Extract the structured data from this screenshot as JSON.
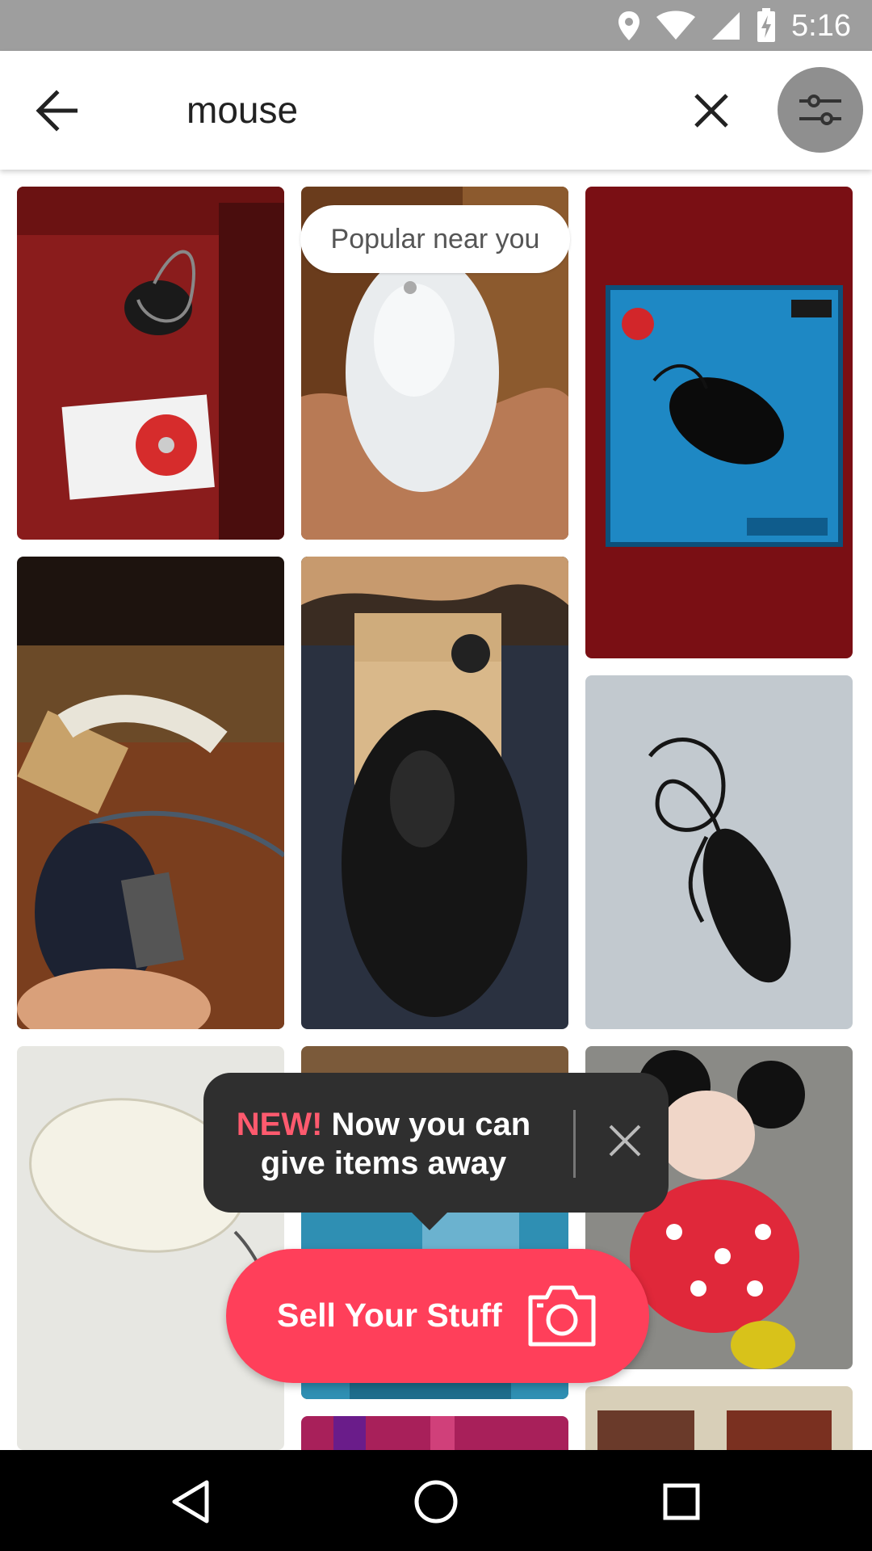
{
  "status_bar": {
    "time": "5:16",
    "icons": [
      "location-icon",
      "wifi-icon",
      "signal-icon",
      "battery-charging-icon"
    ]
  },
  "header": {
    "query": "mouse",
    "icons": [
      "back-arrow-icon",
      "clear-icon",
      "filter-sliders-icon"
    ]
  },
  "grid": {
    "badge_label": "Popular near you"
  },
  "tooltip": {
    "highlight": "NEW!",
    "message": " Now you can give items away",
    "close_icon": "close-icon"
  },
  "sell_button": {
    "label": "Sell Your Stuff",
    "icon": "camera-icon"
  },
  "colors": {
    "accent": "#ff3f5a",
    "new_highlight": "#ff5a6e",
    "status_bar": "#9e9e9e",
    "tooltip_bg": "#2f2f2f"
  },
  "nav_bar": {
    "icons": [
      "nav-back-icon",
      "nav-home-icon",
      "nav-recents-icon"
    ]
  }
}
